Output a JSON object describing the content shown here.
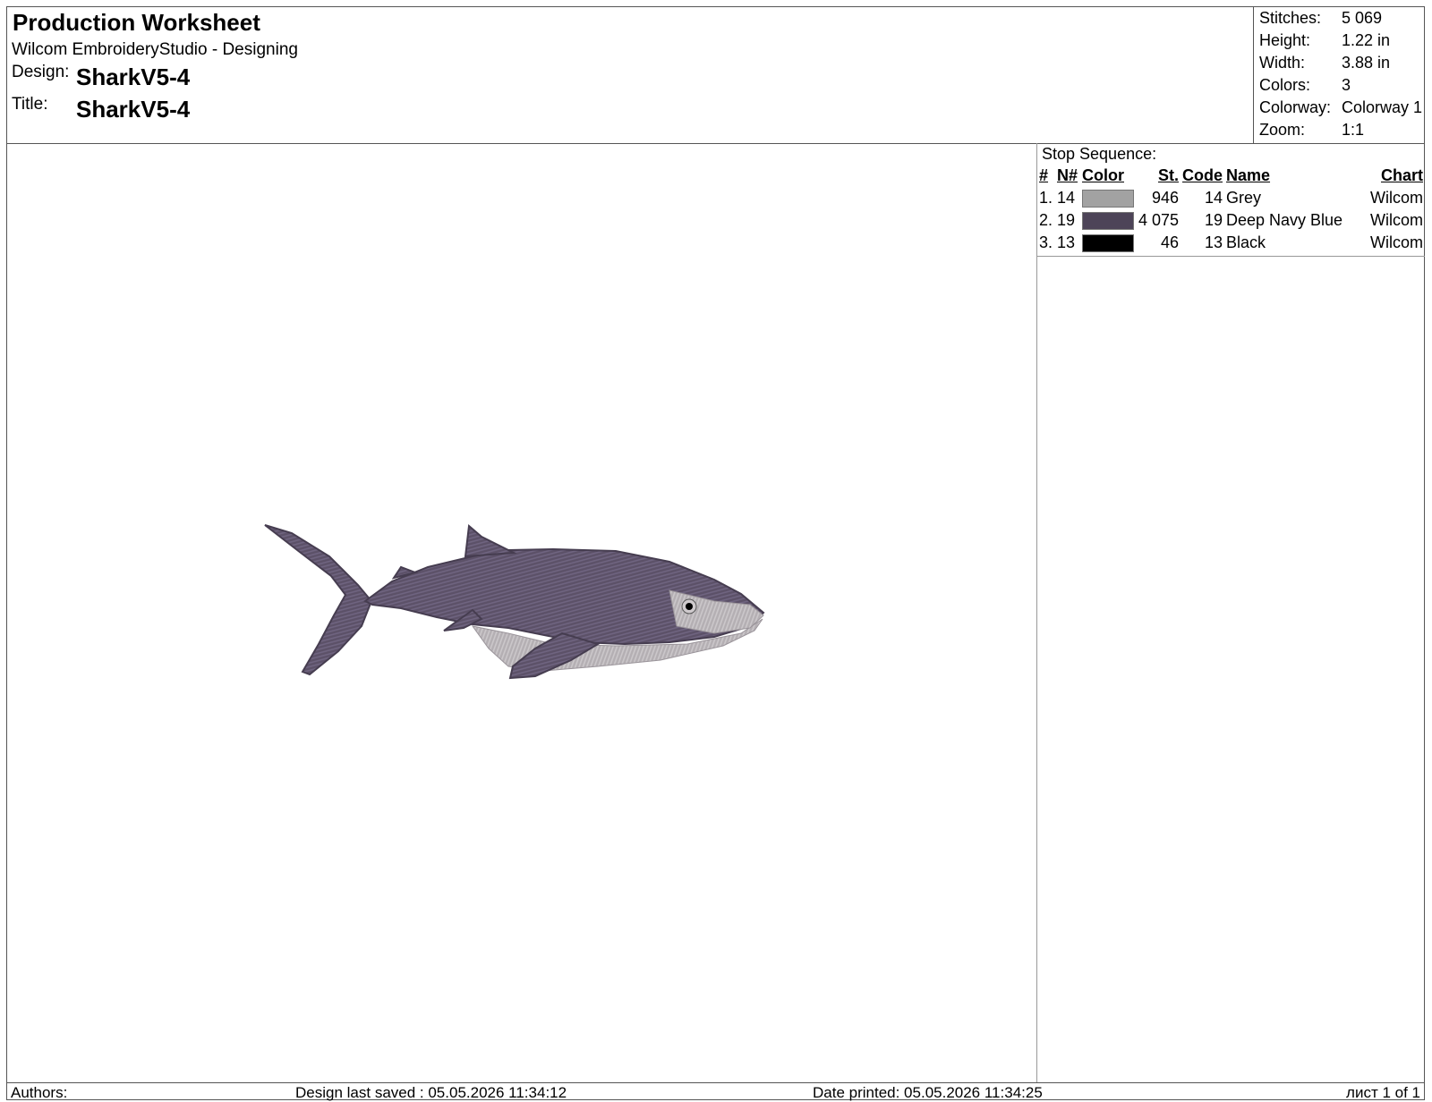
{
  "header": {
    "title": "Production Worksheet",
    "subtitle": "Wilcom EmbroideryStudio - Designing",
    "design_label": "Design:",
    "design_value": "SharkV5-4",
    "title_label": "Title:",
    "title_value": "SharkV5-4"
  },
  "stats": [
    {
      "label": "Stitches:",
      "value": "5 069"
    },
    {
      "label": "Height:",
      "value": "1.22 in"
    },
    {
      "label": "Width:",
      "value": "3.88 in"
    },
    {
      "label": "Colors:",
      "value": "3"
    },
    {
      "label": "Colorway:",
      "value": "Colorway 1"
    },
    {
      "label": "Zoom:",
      "value": "1:1"
    }
  ],
  "stop_sequence": {
    "title": "Stop Sequence:",
    "columns": [
      "#",
      "N#",
      "Color",
      "St.",
      "Code",
      "Name",
      "Chart"
    ],
    "rows": [
      {
        "idx": "1.",
        "n": "14",
        "color": "#a2a2a2",
        "st": "946",
        "code": "14",
        "name": "Grey",
        "chart": "Wilcom"
      },
      {
        "idx": "2.",
        "n": "19",
        "color": "#4d4458",
        "st": "4 075",
        "code": "19",
        "name": "Deep Navy Blue",
        "chart": "Wilcom"
      },
      {
        "idx": "3.",
        "n": "13",
        "color": "#000000",
        "st": "46",
        "code": "13",
        "name": "Black",
        "chart": "Wilcom"
      }
    ]
  },
  "footer": {
    "authors": "Authors:",
    "last_saved": "Design last saved : 05.05.2026 11:34:12",
    "printed": "Date printed: 05.05.2026 11:34:25",
    "page": "лист 1 of 1"
  }
}
